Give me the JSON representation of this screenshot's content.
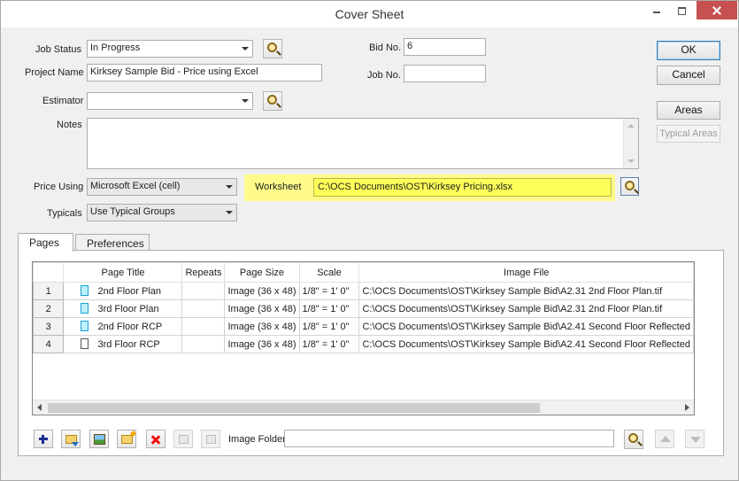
{
  "window": {
    "title": "Cover Sheet"
  },
  "form": {
    "job_status_label": "Job Status",
    "job_status_value": "In Progress",
    "project_name_label": "Project Name",
    "project_name_value": "Kirksey Sample Bid - Price using Excel",
    "estimator_label": "Estimator",
    "estimator_value": "",
    "notes_label": "Notes",
    "notes_value": "",
    "bid_no_label": "Bid No.",
    "bid_no_value": "6",
    "job_no_label": "Job No.",
    "job_no_value": "",
    "price_using_label": "Price Using",
    "price_using_value": "Microsoft Excel (cell)",
    "typicals_label": "Typicals",
    "typicals_value": "Use Typical Groups",
    "worksheet_label": "Worksheet",
    "worksheet_value": "C:\\OCS Documents\\OST\\Kirksey Pricing.xlsx"
  },
  "buttons": {
    "ok": "OK",
    "cancel": "Cancel",
    "areas": "Areas",
    "typical_areas": "Typical Areas"
  },
  "tabs": [
    "Pages",
    "Preferences"
  ],
  "pages_table": {
    "columns": [
      "Page Title",
      "Repeats",
      "Page Size",
      "Scale",
      "Image File"
    ],
    "rows": [
      {
        "num": "1",
        "title": "2nd Floor Plan",
        "repeats": "",
        "size": "Image (36 x 48)",
        "scale": "1/8\" = 1' 0\"",
        "file": "C:\\OCS Documents\\OST\\Kirksey Sample Bid\\A2.31 2nd Floor Plan.tif",
        "icon": "doc-blue-icon"
      },
      {
        "num": "2",
        "title": "3rd Floor Plan",
        "repeats": "",
        "size": "Image (36 x 48)",
        "scale": "1/8\" = 1' 0\"",
        "file": "C:\\OCS Documents\\OST\\Kirksey Sample Bid\\A2.31 2nd Floor Plan.tif",
        "icon": "doc-blue-icon"
      },
      {
        "num": "3",
        "title": "2nd Floor RCP",
        "repeats": "",
        "size": "Image (36 x 48)",
        "scale": "1/8\" = 1' 0\"",
        "file": "C:\\OCS Documents\\OST\\Kirksey Sample Bid\\A2.41 Second Floor Reflected",
        "icon": "doc-blue-icon"
      },
      {
        "num": "4",
        "title": "3rd Floor RCP",
        "repeats": "",
        "size": "Image (36 x 48)",
        "scale": "1/8\" = 1' 0\"",
        "file": "C:\\OCS Documents\\OST\\Kirksey Sample Bid\\A2.41 Second Floor Reflected",
        "icon": "doc-white-icon"
      }
    ]
  },
  "footer": {
    "image_folder_label": "Image Folder",
    "image_folder_value": ""
  },
  "colors": {
    "highlight": "#fefb8a",
    "worksheet_field": "#ffff5a",
    "close_button": "#c75050"
  }
}
